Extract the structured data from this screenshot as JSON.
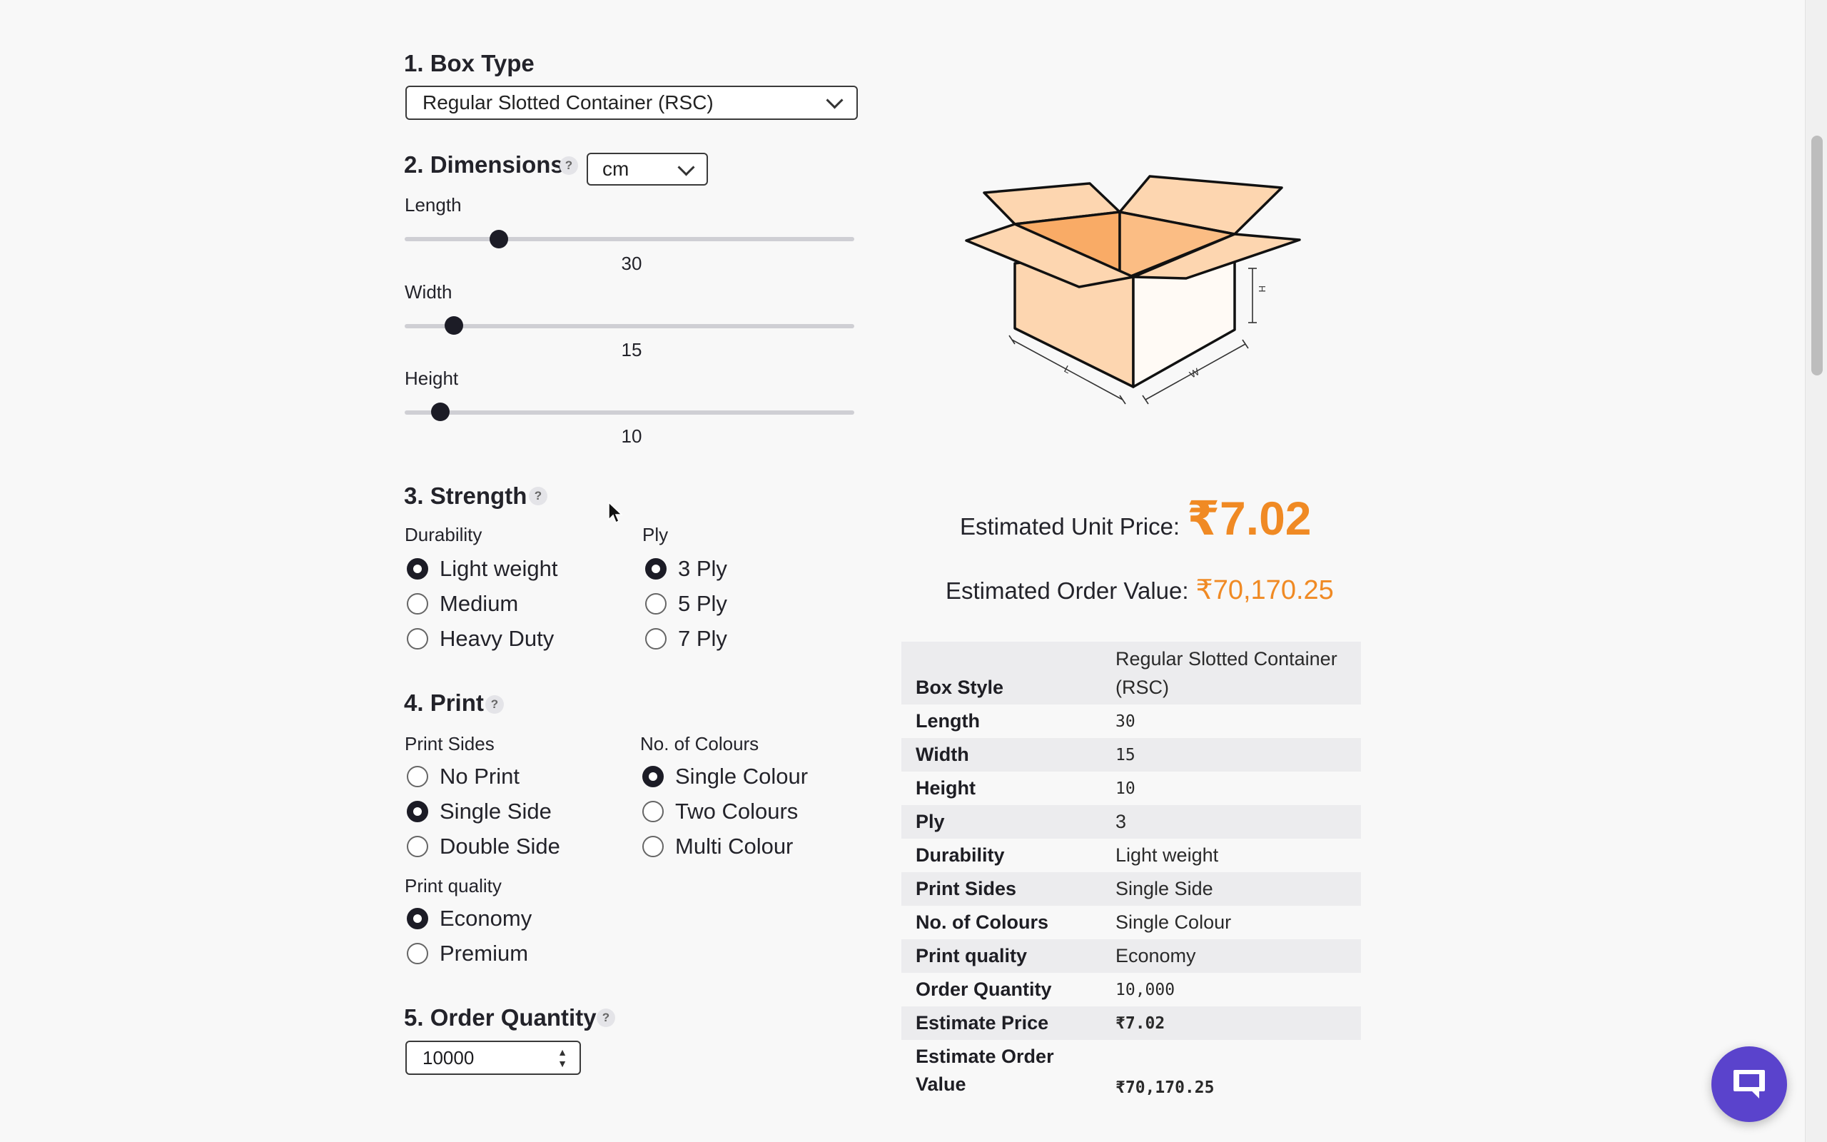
{
  "box_type": {
    "title": "1. Box Type",
    "selected": "Regular Slotted Container (RSC)"
  },
  "dimensions": {
    "title": "2. Dimensions",
    "help": "?",
    "unit": "cm",
    "sliders": [
      {
        "label": "Length",
        "value": "30",
        "fraction": 0.21
      },
      {
        "label": "Width",
        "value": "15",
        "fraction": 0.11
      },
      {
        "label": "Height",
        "value": "10",
        "fraction": 0.08
      }
    ]
  },
  "strength": {
    "title": "3. Strength",
    "help": "?",
    "durability_label": "Durability",
    "durability_options": [
      "Light weight",
      "Medium",
      "Heavy Duty"
    ],
    "durability_selected": 0,
    "ply_label": "Ply",
    "ply_options": [
      "3 Ply",
      "5 Ply",
      "7 Ply"
    ],
    "ply_selected": 0
  },
  "print": {
    "title": "4. Print",
    "help": "?",
    "sides_label": "Print Sides",
    "sides_options": [
      "No Print",
      "Single Side",
      "Double Side"
    ],
    "sides_selected": 1,
    "colours_label": "No. of Colours",
    "colours_options": [
      "Single Colour",
      "Two Colours",
      "Multi Colour"
    ],
    "colours_selected": 0,
    "quality_label": "Print quality",
    "quality_options": [
      "Economy",
      "Premium"
    ],
    "quality_selected": 0
  },
  "order_quantity": {
    "title": "5. Order Quantity",
    "help": "?",
    "value": "10000"
  },
  "illustration": {
    "label_l": "L",
    "label_w": "W",
    "label_h": "H",
    "colors": {
      "light": "#fdd6b0",
      "dark": "#f9ab66",
      "inner": "#fbbd84"
    }
  },
  "estimate": {
    "unit_price_label": "Estimated Unit Price:",
    "unit_price": "₹7.02",
    "order_value_label": "Estimated Order Value:",
    "order_value": "₹70,170.25"
  },
  "summary": [
    {
      "key": "Box Style",
      "value": "Regular Slotted Container (RSC)"
    },
    {
      "key": "Length",
      "value": "30"
    },
    {
      "key": "Width",
      "value": "15"
    },
    {
      "key": "Height",
      "value": "10"
    },
    {
      "key": "Ply",
      "value": "3"
    },
    {
      "key": "Durability",
      "value": "Light weight"
    },
    {
      "key": "Print Sides",
      "value": "Single Side"
    },
    {
      "key": "No. of Colours",
      "value": "Single Colour"
    },
    {
      "key": "Print quality",
      "value": "Economy"
    },
    {
      "key": "Order Quantity",
      "value": "10,000"
    },
    {
      "key": "Estimate Price",
      "value": "₹7.02"
    },
    {
      "key": "Estimate Order Value",
      "value": "₹70,170.25"
    }
  ],
  "theme": {
    "accent": "#f08a24",
    "dark": "#1c1c26",
    "chat": "#5a43cc"
  }
}
